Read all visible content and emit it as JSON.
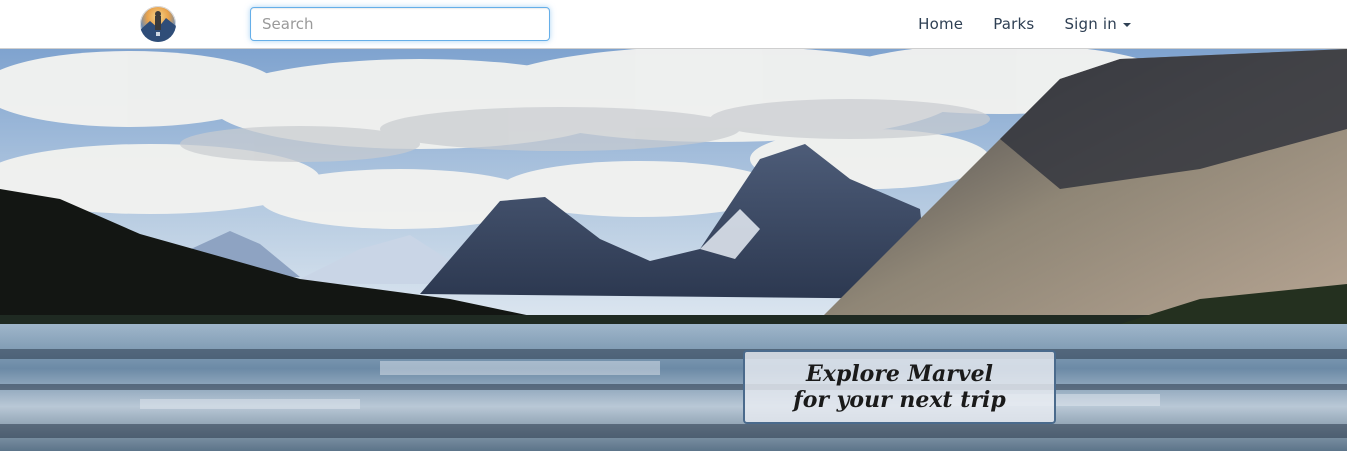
{
  "navbar": {
    "logo_icon": "park-logo-icon",
    "search": {
      "placeholder": "Search",
      "value": ""
    },
    "links": [
      {
        "label": "Home"
      },
      {
        "label": "Parks"
      },
      {
        "label": "Sign in",
        "icon": "caret-down-icon"
      }
    ]
  },
  "hero": {
    "image": "mountain-lake-landscape",
    "tagline": {
      "line1": "Explore Marvel",
      "line2": "for your next trip"
    }
  },
  "colors": {
    "nav_text": "#2f4054",
    "search_focus": "#66afe9",
    "tagline_border": "#4a6a8c"
  }
}
